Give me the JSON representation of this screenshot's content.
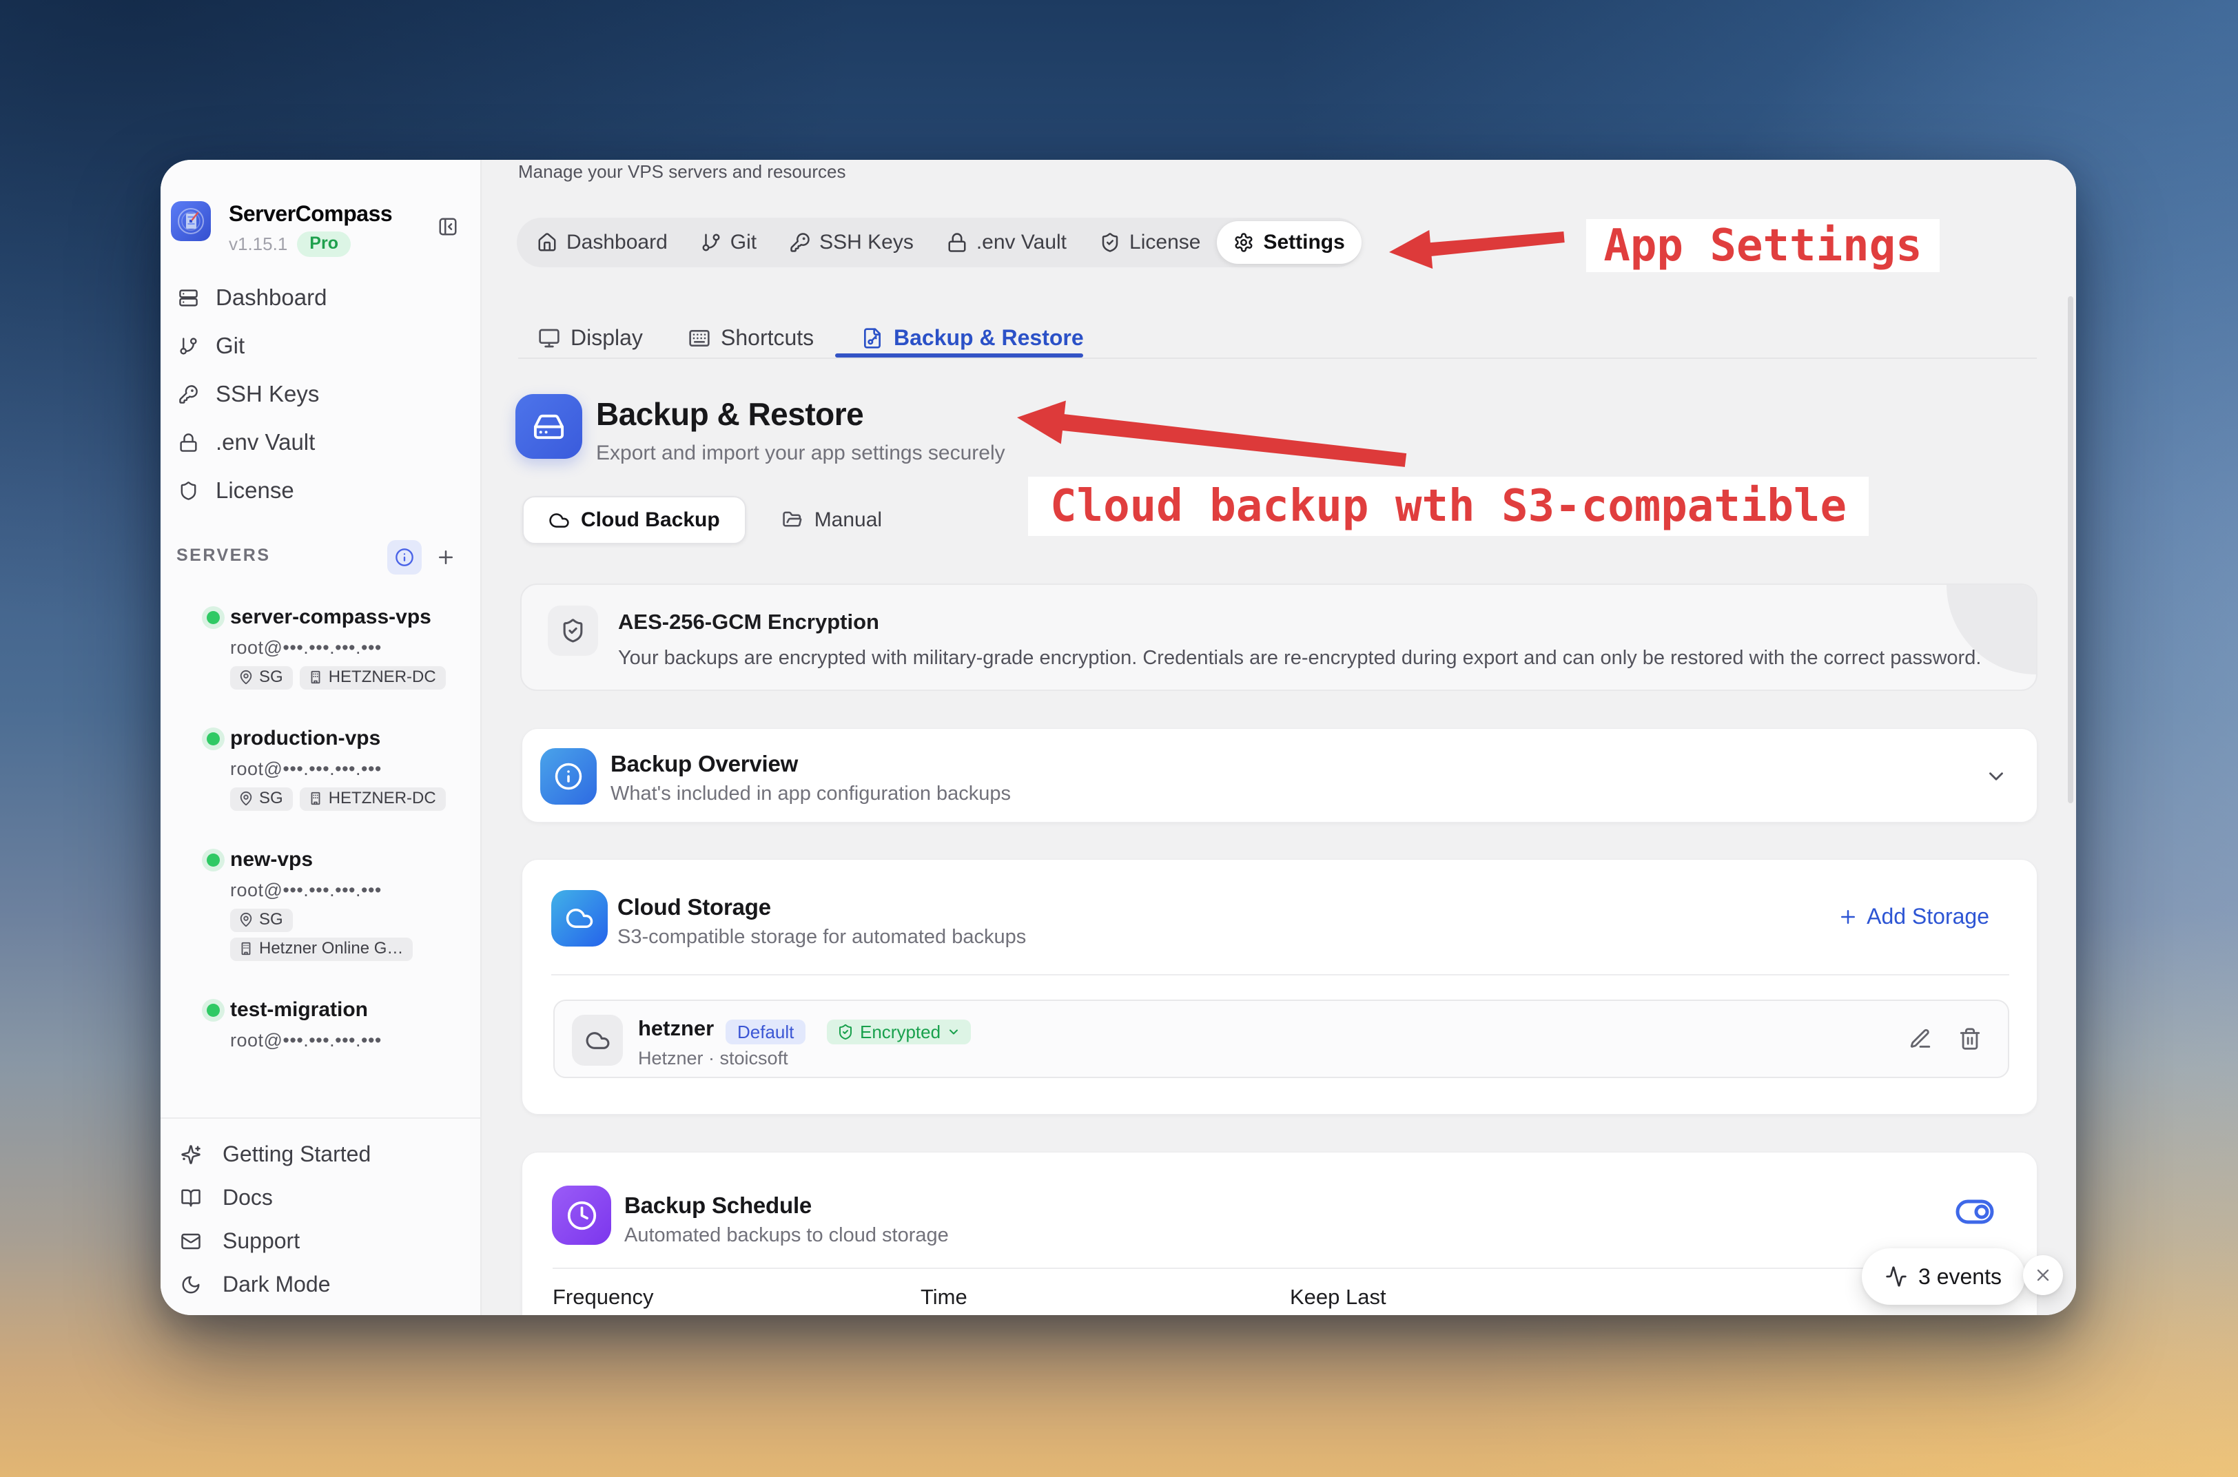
{
  "app": {
    "name": "ServerCompass",
    "version": "v1.15.1",
    "plan_badge": "Pro"
  },
  "sidebar": {
    "nav": [
      {
        "label": "Dashboard"
      },
      {
        "label": "Git"
      },
      {
        "label": "SSH Keys"
      },
      {
        "label": ".env Vault"
      },
      {
        "label": "License"
      }
    ],
    "servers_label": "SERVERS",
    "servers": [
      {
        "name": "server-compass-vps",
        "host": "root@•••.•••.•••.•••",
        "tags": [
          {
            "label": "SG"
          },
          {
            "label": "HETZNER-DC"
          }
        ]
      },
      {
        "name": "production-vps",
        "host": "root@•••.•••.•••.•••",
        "tags": [
          {
            "label": "SG"
          },
          {
            "label": "HETZNER-DC"
          }
        ]
      },
      {
        "name": "new-vps",
        "host": "root@•••.•••.•••.•••",
        "tags": [
          {
            "label": "SG"
          },
          {
            "label": "Hetzner Online G…"
          }
        ]
      },
      {
        "name": "test-migration",
        "host": "root@•••.•••.•••.•••",
        "tags": []
      }
    ],
    "footer": [
      {
        "label": "Getting Started"
      },
      {
        "label": "Docs"
      },
      {
        "label": "Support"
      },
      {
        "label": "Dark Mode"
      }
    ]
  },
  "main": {
    "subtitle": "Manage your VPS servers and resources",
    "tabs": [
      {
        "label": "Dashboard"
      },
      {
        "label": "Git"
      },
      {
        "label": "SSH Keys"
      },
      {
        "label": ".env Vault"
      },
      {
        "label": "License"
      },
      {
        "label": "Settings"
      }
    ],
    "subtabs": [
      {
        "label": "Display"
      },
      {
        "label": "Shortcuts"
      },
      {
        "label": "Backup & Restore"
      }
    ],
    "heading": {
      "title": "Backup & Restore",
      "subtitle": "Export and import your app settings securely"
    },
    "modes": [
      {
        "label": "Cloud Backup"
      },
      {
        "label": "Manual"
      }
    ],
    "encryption": {
      "title": "AES-256-GCM Encryption",
      "body": "Your backups are encrypted with military-grade encryption. Credentials are re-encrypted during export and can only be restored with the correct password."
    },
    "overview": {
      "title": "Backup Overview",
      "subtitle": "What's included in app configuration backups"
    },
    "storage": {
      "title": "Cloud Storage",
      "subtitle": "S3-compatible storage for automated backups",
      "add_label": "Add Storage",
      "item": {
        "name": "hetzner",
        "default_badge": "Default",
        "encrypted_badge": "Encrypted",
        "meta": "Hetzner · stoicsoft"
      }
    },
    "schedule": {
      "title": "Backup Schedule",
      "subtitle": "Automated backups to cloud storage",
      "columns": [
        {
          "label": "Frequency"
        },
        {
          "label": "Time"
        },
        {
          "label": "Keep Last"
        }
      ]
    },
    "events_label": "3 events"
  },
  "annotations": {
    "settings": "App Settings",
    "cloud": "Cloud backup wth S3-compatible"
  },
  "colors": {
    "accent_blue": "#2b51c7",
    "annotation_red": "#e03e3e",
    "green": "#1fa04d",
    "purple": "#7c36ed"
  }
}
